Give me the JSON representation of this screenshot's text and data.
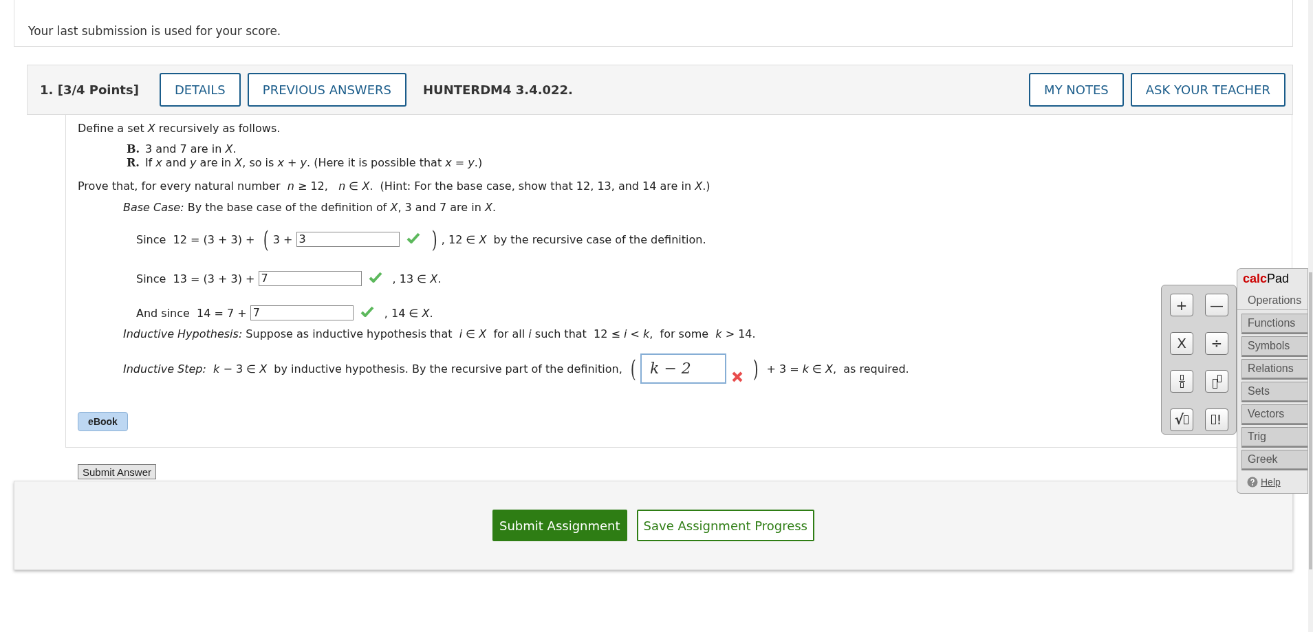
{
  "notice": "Your last submission is used for your score.",
  "question": {
    "number": "1.",
    "points": "[3/4 Points]",
    "code": "HUNTERDM4 3.4.022.",
    "left_buttons": [
      "DETAILS",
      "PREVIOUS ANSWERS"
    ],
    "right_buttons": [
      "MY NOTES",
      "ASK YOUR TEACHER"
    ]
  },
  "intro": "Define a set *X* recursively as follows.",
  "rules": [
    {
      "label": "B.",
      "text": "3 and 7 are in *X*."
    },
    {
      "label": "R.",
      "text": "If *x* and *y* are in *X*, so is *x* + *y*. (Here it is possible that *x* = *y*.)"
    }
  ],
  "prove": "Prove that, for every natural number  *n* ≥ 12,   *n* ∈ *X*.  (Hint: For the base case, show that 12, 13, and 14 are in *X*.)",
  "base_case": "*Base Case:* By the base case of the definition of *X*, 3 and 7 are in *X*.",
  "answer_lines": [
    {
      "parts": [
        {
          "kind": "text",
          "text": "Since  12 = (3 + 3) + "
        },
        {
          "kind": "paren",
          "text": "("
        },
        {
          "kind": "text",
          "text": "3 + "
        },
        {
          "kind": "answer",
          "value": "3",
          "correct": true
        },
        {
          "kind": "paren",
          "text": ")"
        },
        {
          "kind": "text",
          "text": ", 12 ∈ *X*  by the recursive case of the definition."
        }
      ]
    },
    {
      "parts": [
        {
          "kind": "text",
          "text": "Since  13 = (3 + 3) + "
        },
        {
          "kind": "answer",
          "value": "7",
          "correct": true
        },
        {
          "kind": "text",
          "text": " , 13 ∈ *X*."
        }
      ]
    },
    {
      "parts": [
        {
          "kind": "text",
          "text": "And since  14 = 7 + "
        },
        {
          "kind": "answer",
          "value": "7",
          "correct": true
        },
        {
          "kind": "text",
          "text": " , 14 ∈ *X*."
        }
      ]
    }
  ],
  "hypothesis": "*Inductive Hypothesis:* Suppose as inductive hypothesis that  *i* ∈ *X*  for all *i* such that  12 ≤ *i* < *k*,  for some  *k* > 14.",
  "step": {
    "parts": [
      {
        "kind": "text",
        "text": "*Inductive Step:*  *k* − 3 ∈ *X*  by inductive hypothesis. By the recursive part of the definition, "
      },
      {
        "kind": "paren",
        "text": "("
      },
      {
        "kind": "math_answer",
        "value": "k − 2",
        "correct": false
      },
      {
        "kind": "paren",
        "text": ")"
      },
      {
        "kind": "text",
        "text": " + 3 = *k* ∈ *X*,  as required."
      }
    ]
  },
  "ebook": "eBook",
  "submit_answer": "Submit Answer",
  "calcpad": {
    "title": "**calc**Pad",
    "keys": [
      {
        "kind": "glyph",
        "text": "+"
      },
      {
        "kind": "glyph",
        "text": "—"
      },
      {
        "kind": "glyph",
        "text": "X"
      },
      {
        "kind": "glyph",
        "text": "÷"
      },
      {
        "kind": "fraction"
      },
      {
        "kind": "power"
      },
      {
        "kind": "sqrt",
        "text": "√"
      },
      {
        "kind": "factorial",
        "text": "!"
      }
    ],
    "tabs": [
      {
        "label": "Operations",
        "selected": true
      },
      {
        "label": "Functions",
        "selected": false
      },
      {
        "label": "Symbols",
        "selected": false
      },
      {
        "label": "Relations",
        "selected": false
      },
      {
        "label": "Sets",
        "selected": false
      },
      {
        "label": "Vectors",
        "selected": false
      },
      {
        "label": "Trig",
        "selected": false
      },
      {
        "label": "Greek",
        "selected": false
      }
    ],
    "help": "Help"
  },
  "footer_buttons": [
    {
      "label": "Submit Assignment",
      "kind": "primary"
    },
    {
      "label": "Save Assignment Progress",
      "kind": "secondary"
    }
  ]
}
